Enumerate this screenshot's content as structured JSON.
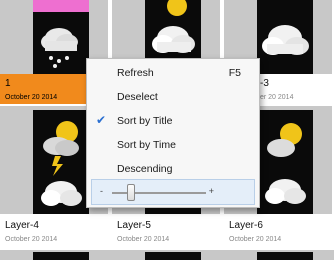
{
  "gallery": {
    "items": [
      {
        "label": "1",
        "date": "October 20 2014",
        "selected": true,
        "icon": "cloud-snow-icon"
      },
      {
        "label": "",
        "date": "",
        "selected": false,
        "icon": "sun-cloud-icon"
      },
      {
        "label": "-3",
        "date": "er 20 2014",
        "selected": false,
        "icon": "cloud-icon"
      },
      {
        "label": "Layer-4",
        "date": "October 20 2014",
        "selected": false,
        "icon": "sun-storm-icon"
      },
      {
        "label": "Layer-5",
        "date": "October 20 2014",
        "selected": false,
        "icon": "cloud-icon"
      },
      {
        "label": "Layer-6",
        "date": "October 20 2014",
        "selected": false,
        "icon": "sun-cloud-icon"
      }
    ]
  },
  "context_menu": {
    "items": [
      {
        "label": "Refresh",
        "shortcut": "F5",
        "checked": false
      },
      {
        "label": "Deselect",
        "shortcut": "",
        "checked": false
      },
      {
        "label": "Sort by Title",
        "shortcut": "",
        "checked": true
      },
      {
        "label": "Sort by Time",
        "shortcut": "",
        "checked": false
      },
      {
        "label": "Descending",
        "shortcut": "",
        "checked": false
      }
    ],
    "zoom": {
      "minus": "-",
      "plus": "+",
      "level": 0.2
    }
  },
  "colors": {
    "selection": "#f18a1c",
    "menu_highlight": "#e4eef9",
    "check": "#2a6fd1"
  }
}
